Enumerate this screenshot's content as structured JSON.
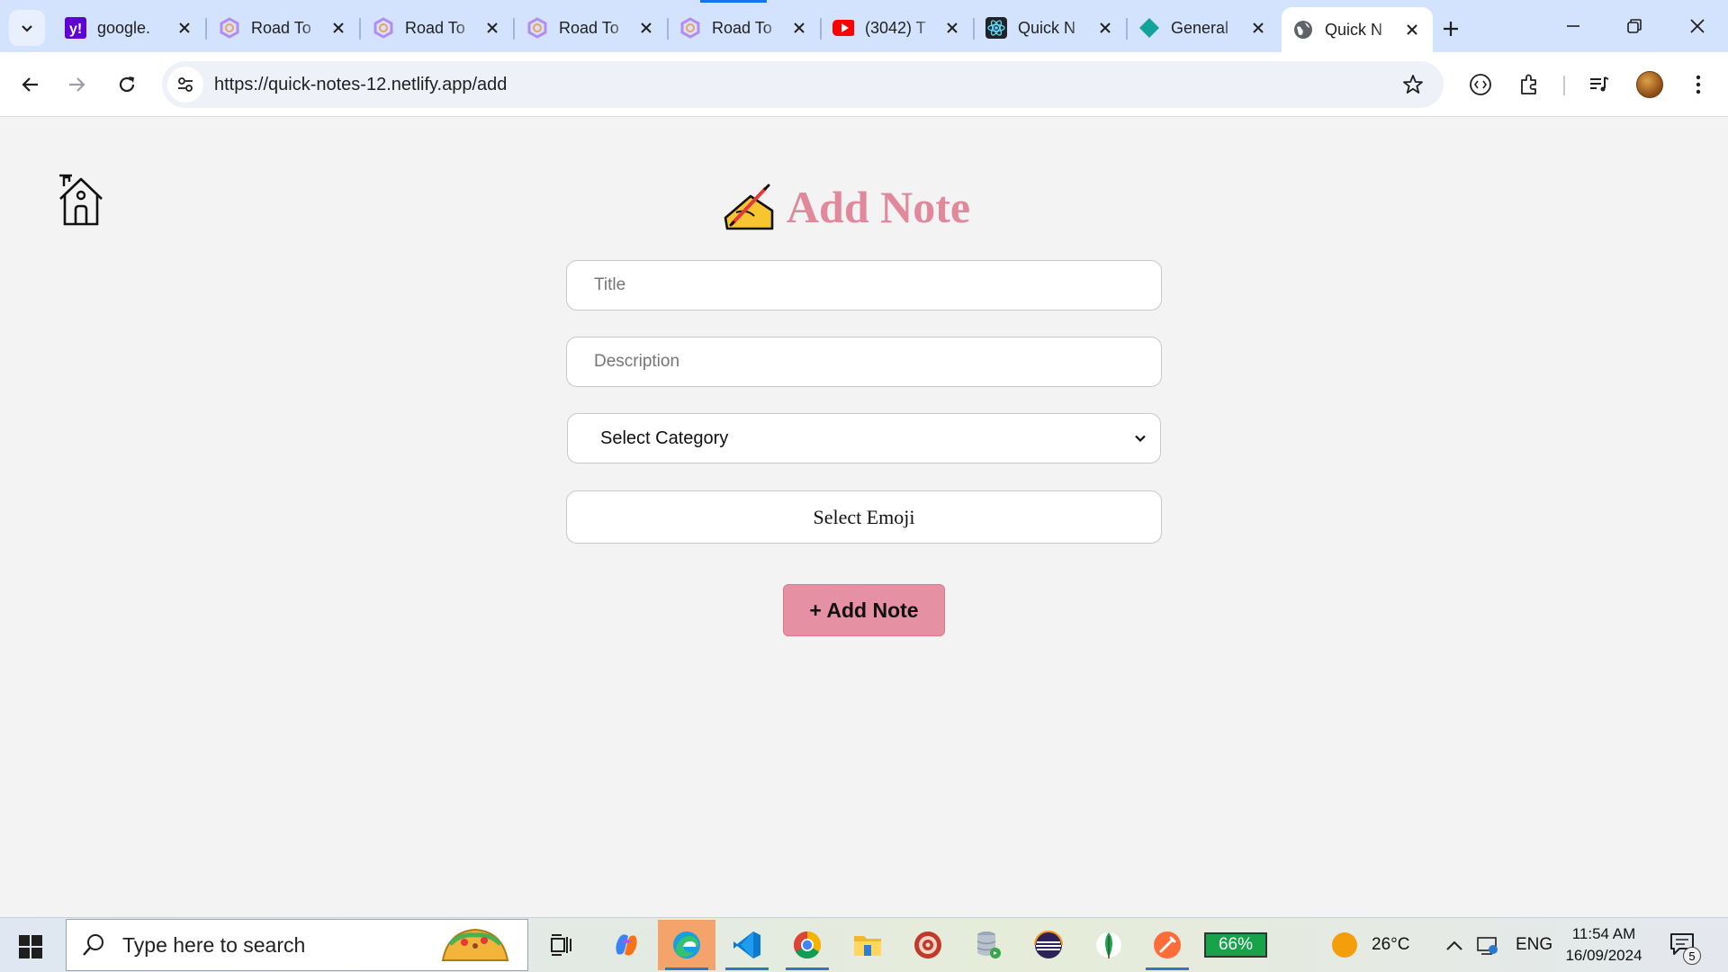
{
  "browser": {
    "tabs": [
      {
        "title": "google.",
        "favicon": "yahoo-icon"
      },
      {
        "title": "Road To",
        "favicon": "roadmap-icon"
      },
      {
        "title": "Road To",
        "favicon": "roadmap-icon"
      },
      {
        "title": "Road To",
        "favicon": "roadmap-icon"
      },
      {
        "title": "Road To",
        "favicon": "roadmap-icon"
      },
      {
        "title": "(3042) T",
        "favicon": "youtube-icon"
      },
      {
        "title": "Quick N",
        "favicon": "react-icon"
      },
      {
        "title": "General",
        "favicon": "diamond-icon"
      },
      {
        "title": "Quick N",
        "favicon": "globe-icon",
        "active": true
      }
    ],
    "url": "https://quick-notes-12.netlify.app/add"
  },
  "page": {
    "heading": "Add Note",
    "title_placeholder": "Title",
    "description_placeholder": "Description",
    "category_selected": "Select Category",
    "emoji_button": "Select Emoji",
    "submit_button": "+ Add Note",
    "colors": {
      "accent": "#e0899a",
      "button": "#e590a3"
    }
  },
  "taskbar": {
    "search_placeholder": "Type here to search",
    "battery": "66%",
    "temperature": "26°C",
    "language": "ENG",
    "time": "11:54 AM",
    "date": "16/09/2024",
    "notifications": "5"
  }
}
